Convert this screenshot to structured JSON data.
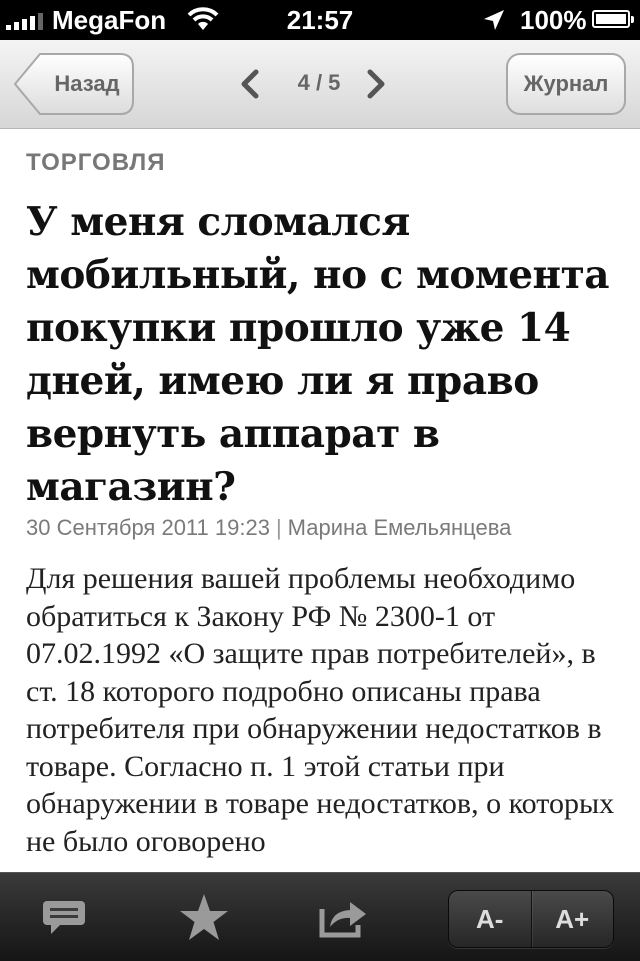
{
  "status_bar": {
    "carrier": "MegaFon",
    "time": "21:57",
    "battery": "100%"
  },
  "nav": {
    "back_label": "Назад",
    "pager": "4 / 5",
    "journal_label": "Журнал"
  },
  "article": {
    "category": "ТОРГОВЛЯ",
    "title": "У меня сломался мобильный, но с момента покупки прошло уже 14 дней, имею ли я право вернуть аппарат в магазин?",
    "date": "30 Сентября 2011 19:23",
    "separator": "|",
    "author": "Марина Емельянцева",
    "body": "Для решения вашей проблемы необходимо обратиться к Закону РФ № 2300-1 от 07.02.1992 «О защите прав потребителей», в ст. 18 которого подробно описаны права потребителя при обнаружении недостатков в товаре. Согласно п. 1 этой статьи при обнаружении в товаре недостатков, о которых не было оговорено"
  },
  "toolbar": {
    "font_decrease": "A-",
    "font_increase": "A+",
    "icons": [
      "comments-icon",
      "star-icon",
      "share-icon"
    ]
  },
  "colors": {
    "status_bg": "#000000",
    "nav_bg": "#e6e6e6",
    "toolbar_bg": "#1f1f1f",
    "title_text": "#111111",
    "meta_text": "#7a7a7a"
  }
}
